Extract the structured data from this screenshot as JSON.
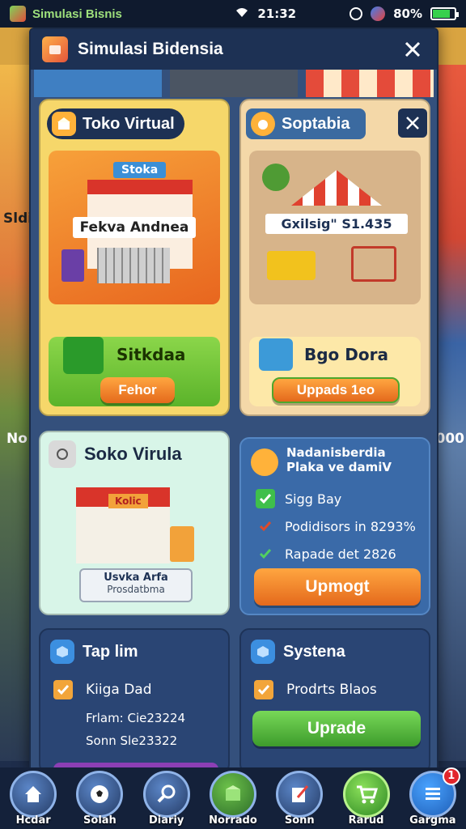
{
  "status_bar": {
    "app_name": "Simulasi Bisnis",
    "time": "21:32",
    "battery": "80%",
    "battery_level": 0.8
  },
  "background": {
    "left_text_1": "Sldi",
    "left_text_2": "No",
    "right_text": "000"
  },
  "modal": {
    "title": "Simulasi Bidensia",
    "card1": {
      "title": "Toko Virtual",
      "sign": "Stoka",
      "banner": "Fekva Andnea",
      "section_label": "Sitkdaa",
      "button": "Fehor"
    },
    "card2": {
      "title": "Soptabia",
      "banner": "Gxilsig\" S1.435",
      "section_label": "Bgo Dora",
      "button": "Uppads 1eo"
    },
    "card3": {
      "title": "Soko Virula",
      "shop_sign": "Kolic",
      "chip_line1": "Usvka Arfa",
      "chip_line2": "Prosdatbma"
    },
    "card4": {
      "title_line1": "Nadanisberdia",
      "title_line2": "Plaka ve damiV",
      "checks": [
        "Sigg Bay",
        "Podidisors in 8293%",
        "Rapade det 2826"
      ],
      "button": "Upmogt"
    },
    "card5": {
      "title": "Tap lim",
      "check": "Kiiga Dad",
      "line1": "Frlam: Cie23224",
      "line2": "Sonn Sle23322"
    },
    "card6": {
      "title": "Systena",
      "check": "Prodrts Blaos",
      "button": "Uprade"
    }
  },
  "bottom_nav": [
    {
      "label": "Hcdar",
      "icon": "home-icon"
    },
    {
      "label": "Solah",
      "icon": "soccer-icon"
    },
    {
      "label": "Diariy",
      "icon": "search-icon"
    },
    {
      "label": "Norrado",
      "icon": "box-icon"
    },
    {
      "label": "Sonn",
      "icon": "edit-icon"
    },
    {
      "label": "Rarud",
      "icon": "cart-icon"
    },
    {
      "label": "Gargma",
      "icon": "list-icon",
      "badge": "1"
    }
  ]
}
